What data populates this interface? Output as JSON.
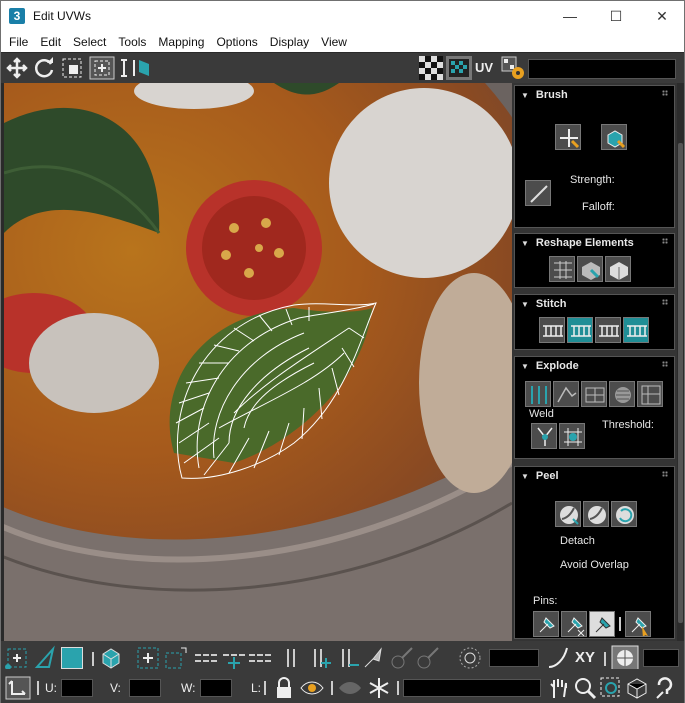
{
  "window": {
    "app_icon_label": "3",
    "title": "Edit UVWs",
    "minimize_glyph": "—",
    "maximize_glyph": "☐",
    "close_glyph": "✕"
  },
  "menu": [
    "File",
    "Edit",
    "Select",
    "Tools",
    "Mapping",
    "Options",
    "Display",
    "View"
  ],
  "toolbar": {
    "uv_label": "UV"
  },
  "panel": {
    "brush": {
      "title": "Brush",
      "strength_label": "Strength:",
      "falloff_label": "Falloff:"
    },
    "reshape": {
      "title": "Reshape Elements"
    },
    "stitch": {
      "title": "Stitch"
    },
    "explode": {
      "title": "Explode",
      "weld_label": "Weld",
      "threshold_label": "Threshold:"
    },
    "peel": {
      "title": "Peel",
      "detach_label": "Detach",
      "avoid_overlap_label": "Avoid Overlap",
      "pins_label": "Pins:"
    }
  },
  "bottom": {
    "xy_label": "XY",
    "u_label": "U:",
    "v_label": "V:",
    "w_label": "W:",
    "l_label": "L:"
  },
  "colors": {
    "accent": "#1f8e96",
    "panel_bg": "#000000",
    "toolbar_bg": "#3a3a3a"
  }
}
